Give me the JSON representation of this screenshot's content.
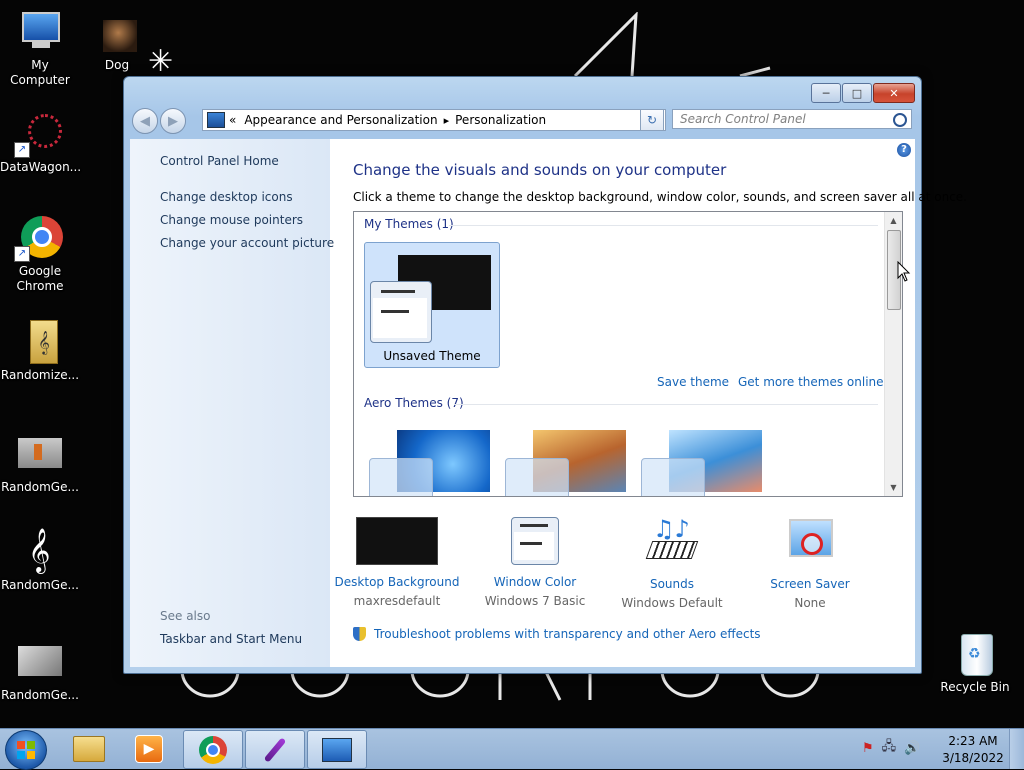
{
  "desktop": {
    "icons": [
      {
        "label": "My Computer"
      },
      {
        "label": "Dog"
      },
      {
        "label": "DataWagon..."
      },
      {
        "label": "Google Chrome"
      },
      {
        "label": "Randomize..."
      },
      {
        "label": "RandomGe..."
      },
      {
        "label": "RandomGe..."
      },
      {
        "label": "RandomGe..."
      },
      {
        "label": "Recycle Bin"
      }
    ]
  },
  "window": {
    "caption": {
      "minimize": "─",
      "maximize": "□",
      "close": "✕"
    },
    "nav": {
      "back": "◀",
      "forward": "▶"
    },
    "address": {
      "prefix": "«",
      "crumbs": [
        "Appearance and Personalization",
        "Personalization"
      ],
      "separator": "▸",
      "dropdown": "▾"
    },
    "refresh_label": "↻",
    "search": {
      "placeholder": "Search Control Panel"
    },
    "sidebar": {
      "home": "Control Panel Home",
      "links": [
        "Change desktop icons",
        "Change mouse pointers",
        "Change your account picture"
      ],
      "see_also_heading": "See also",
      "see_also": [
        "Taskbar and Start Menu"
      ]
    },
    "main": {
      "help_label": "?",
      "title": "Change the visuals and sounds on your computer",
      "description": "Click a theme to change the desktop background, window color, sounds, and screen saver all at once.",
      "my_themes_heading": "My Themes (1)",
      "unsaved_theme": "Unsaved Theme",
      "save_theme": "Save theme",
      "get_more_themes": "Get more themes online",
      "aero_heading": "Aero Themes (7)",
      "scroll_up": "▲",
      "scroll_down": "▼",
      "settings": [
        {
          "title": "Desktop Background",
          "value": "maxresdefault"
        },
        {
          "title": "Window Color",
          "value": "Windows 7 Basic"
        },
        {
          "title": "Sounds",
          "value": "Windows Default"
        },
        {
          "title": "Screen Saver",
          "value": "None"
        }
      ],
      "troubleshoot": "Troubleshoot problems with transparency and other Aero effects"
    }
  },
  "taskbar": {
    "clock_time": "2:23 AM",
    "clock_date": "3/18/2022",
    "tray_icons": [
      "flag-icon",
      "network-icon",
      "volume-icon"
    ]
  },
  "colors": {
    "link": "#1565b8",
    "heading": "#1e3287",
    "taskbar": "#a9c3e0"
  }
}
